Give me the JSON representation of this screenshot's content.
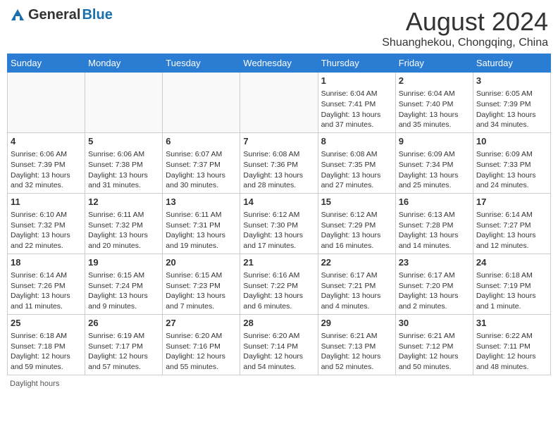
{
  "header": {
    "logo_general": "General",
    "logo_blue": "Blue",
    "month": "August 2024",
    "location": "Shuanghekou, Chongqing, China"
  },
  "weekdays": [
    "Sunday",
    "Monday",
    "Tuesday",
    "Wednesday",
    "Thursday",
    "Friday",
    "Saturday"
  ],
  "weeks": [
    [
      {
        "day": "",
        "info": ""
      },
      {
        "day": "",
        "info": ""
      },
      {
        "day": "",
        "info": ""
      },
      {
        "day": "",
        "info": ""
      },
      {
        "day": "1",
        "info": "Sunrise: 6:04 AM\nSunset: 7:41 PM\nDaylight: 13 hours and 37 minutes."
      },
      {
        "day": "2",
        "info": "Sunrise: 6:04 AM\nSunset: 7:40 PM\nDaylight: 13 hours and 35 minutes."
      },
      {
        "day": "3",
        "info": "Sunrise: 6:05 AM\nSunset: 7:39 PM\nDaylight: 13 hours and 34 minutes."
      }
    ],
    [
      {
        "day": "4",
        "info": "Sunrise: 6:06 AM\nSunset: 7:39 PM\nDaylight: 13 hours and 32 minutes."
      },
      {
        "day": "5",
        "info": "Sunrise: 6:06 AM\nSunset: 7:38 PM\nDaylight: 13 hours and 31 minutes."
      },
      {
        "day": "6",
        "info": "Sunrise: 6:07 AM\nSunset: 7:37 PM\nDaylight: 13 hours and 30 minutes."
      },
      {
        "day": "7",
        "info": "Sunrise: 6:08 AM\nSunset: 7:36 PM\nDaylight: 13 hours and 28 minutes."
      },
      {
        "day": "8",
        "info": "Sunrise: 6:08 AM\nSunset: 7:35 PM\nDaylight: 13 hours and 27 minutes."
      },
      {
        "day": "9",
        "info": "Sunrise: 6:09 AM\nSunset: 7:34 PM\nDaylight: 13 hours and 25 minutes."
      },
      {
        "day": "10",
        "info": "Sunrise: 6:09 AM\nSunset: 7:33 PM\nDaylight: 13 hours and 24 minutes."
      }
    ],
    [
      {
        "day": "11",
        "info": "Sunrise: 6:10 AM\nSunset: 7:32 PM\nDaylight: 13 hours and 22 minutes."
      },
      {
        "day": "12",
        "info": "Sunrise: 6:11 AM\nSunset: 7:32 PM\nDaylight: 13 hours and 20 minutes."
      },
      {
        "day": "13",
        "info": "Sunrise: 6:11 AM\nSunset: 7:31 PM\nDaylight: 13 hours and 19 minutes."
      },
      {
        "day": "14",
        "info": "Sunrise: 6:12 AM\nSunset: 7:30 PM\nDaylight: 13 hours and 17 minutes."
      },
      {
        "day": "15",
        "info": "Sunrise: 6:12 AM\nSunset: 7:29 PM\nDaylight: 13 hours and 16 minutes."
      },
      {
        "day": "16",
        "info": "Sunrise: 6:13 AM\nSunset: 7:28 PM\nDaylight: 13 hours and 14 minutes."
      },
      {
        "day": "17",
        "info": "Sunrise: 6:14 AM\nSunset: 7:27 PM\nDaylight: 13 hours and 12 minutes."
      }
    ],
    [
      {
        "day": "18",
        "info": "Sunrise: 6:14 AM\nSunset: 7:26 PM\nDaylight: 13 hours and 11 minutes."
      },
      {
        "day": "19",
        "info": "Sunrise: 6:15 AM\nSunset: 7:24 PM\nDaylight: 13 hours and 9 minutes."
      },
      {
        "day": "20",
        "info": "Sunrise: 6:15 AM\nSunset: 7:23 PM\nDaylight: 13 hours and 7 minutes."
      },
      {
        "day": "21",
        "info": "Sunrise: 6:16 AM\nSunset: 7:22 PM\nDaylight: 13 hours and 6 minutes."
      },
      {
        "day": "22",
        "info": "Sunrise: 6:17 AM\nSunset: 7:21 PM\nDaylight: 13 hours and 4 minutes."
      },
      {
        "day": "23",
        "info": "Sunrise: 6:17 AM\nSunset: 7:20 PM\nDaylight: 13 hours and 2 minutes."
      },
      {
        "day": "24",
        "info": "Sunrise: 6:18 AM\nSunset: 7:19 PM\nDaylight: 13 hours and 1 minute."
      }
    ],
    [
      {
        "day": "25",
        "info": "Sunrise: 6:18 AM\nSunset: 7:18 PM\nDaylight: 12 hours and 59 minutes."
      },
      {
        "day": "26",
        "info": "Sunrise: 6:19 AM\nSunset: 7:17 PM\nDaylight: 12 hours and 57 minutes."
      },
      {
        "day": "27",
        "info": "Sunrise: 6:20 AM\nSunset: 7:16 PM\nDaylight: 12 hours and 55 minutes."
      },
      {
        "day": "28",
        "info": "Sunrise: 6:20 AM\nSunset: 7:14 PM\nDaylight: 12 hours and 54 minutes."
      },
      {
        "day": "29",
        "info": "Sunrise: 6:21 AM\nSunset: 7:13 PM\nDaylight: 12 hours and 52 minutes."
      },
      {
        "day": "30",
        "info": "Sunrise: 6:21 AM\nSunset: 7:12 PM\nDaylight: 12 hours and 50 minutes."
      },
      {
        "day": "31",
        "info": "Sunrise: 6:22 AM\nSunset: 7:11 PM\nDaylight: 12 hours and 48 minutes."
      }
    ]
  ],
  "footer": {
    "daylight_label": "Daylight hours"
  }
}
